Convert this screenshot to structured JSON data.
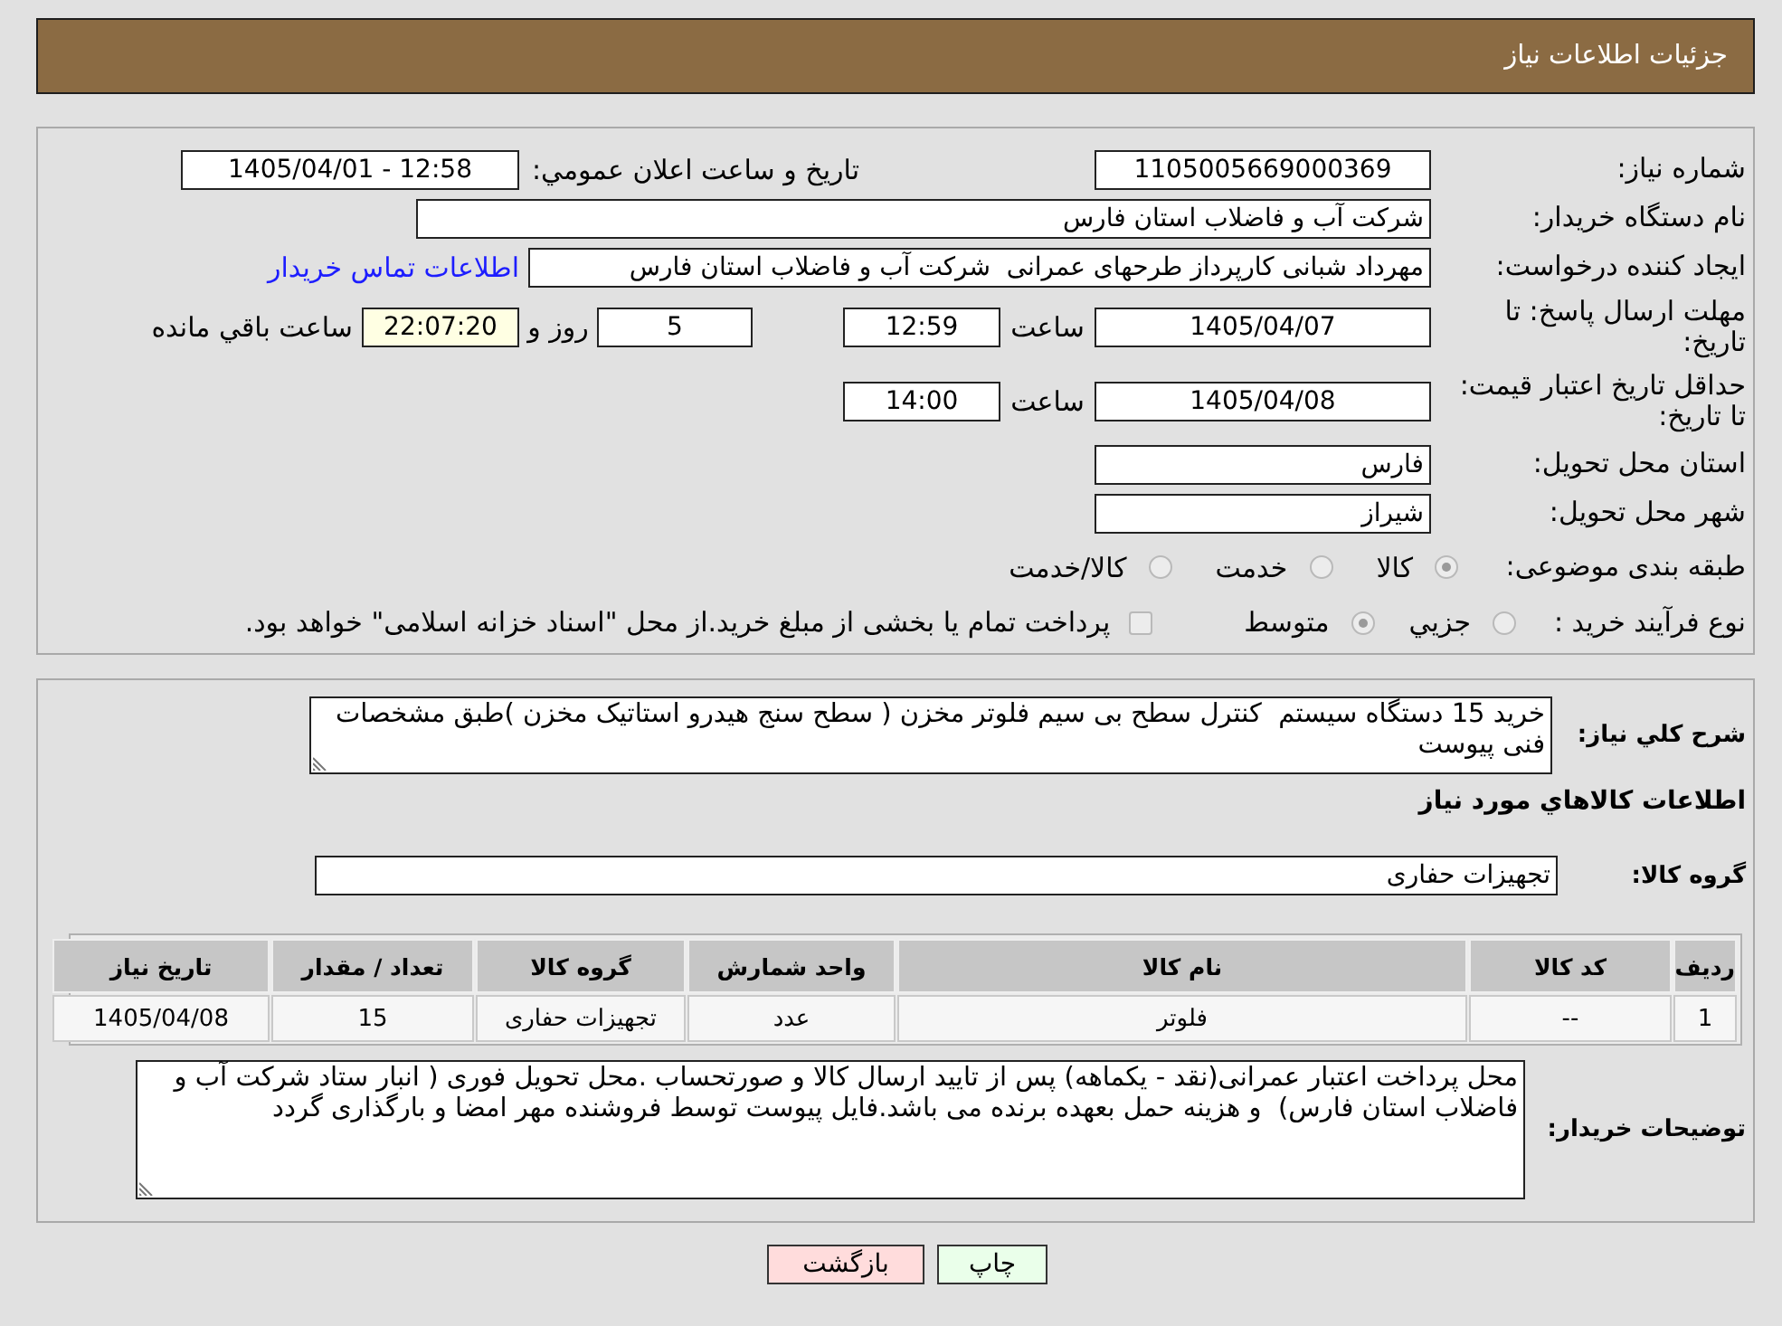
{
  "header": {
    "title": "جزئیات اطلاعات نیاز"
  },
  "details": {
    "need_number": {
      "label": "شماره نیاز:",
      "value": "1105005669000369"
    },
    "announcement": {
      "label": "تاریخ و ساعت اعلان عمومي:",
      "value": "1405/04/01 - 12:58"
    },
    "buyer_org": {
      "label": "نام دستگاه خریدار:",
      "value": "شرکت آب و فاضلاب استان فارس"
    },
    "requester": {
      "label": "ایجاد کننده درخواست:",
      "value": "مهرداد شبانی کارپرداز طرحهای عمرانی  شرکت آب و فاضلاب استان فارس",
      "contact_link": "اطلاعات تماس خریدار"
    },
    "response_deadline": {
      "label": "مهلت ارسال پاسخ: تا تاریخ:",
      "date": "1405/04/07",
      "time_label": "ساعت",
      "time": "12:59",
      "days": "5",
      "days_label": "روز و",
      "remaining": "22:07:20",
      "remaining_label": "ساعت باقي مانده"
    },
    "price_validity": {
      "label": "حداقل تاریخ اعتبار قیمت: تا تاریخ:",
      "date": "1405/04/08",
      "time_label": "ساعت",
      "time": "14:00"
    },
    "delivery_province": {
      "label": "استان محل تحویل:",
      "value": "فارس"
    },
    "delivery_city": {
      "label": "شهر محل تحویل:",
      "value": "شیراز"
    },
    "category": {
      "label": "طبقه بندی موضوعی:",
      "options": [
        {
          "label": "کالا",
          "selected": true,
          "disabled": true
        },
        {
          "label": "خدمت",
          "selected": false,
          "disabled": true
        },
        {
          "label": "کالا/خدمت",
          "selected": false,
          "disabled": true
        }
      ]
    },
    "purchase_process": {
      "label": "نوع فرآیند خرید :",
      "options": [
        {
          "label": "جزيي",
          "selected": false,
          "disabled": true
        },
        {
          "label": "متوسط",
          "selected": true,
          "disabled": true
        }
      ],
      "treasury": {
        "label": "پرداخت تمام یا بخشی از مبلغ خرید.از محل \"اسناد خزانه اسلامی\" خواهد بود.",
        "checked": false,
        "disabled": true
      }
    }
  },
  "description": {
    "label": "شرح کلي نیاز:",
    "value": "خرید 15 دستگاه سیستم  کنترل سطح بی سیم فلوتر مخزن ( سطح سنج هیدرو استاتیک مخزن )طبق مشخصات فنی پیوست"
  },
  "goods": {
    "title": "اطلاعات کالاهاي مورد نیاز",
    "group_label": "گروه کالا:",
    "group_value": "تجهیزات حفاری",
    "table": {
      "columns": [
        "ردیف",
        "کد کالا",
        "نام کالا",
        "واحد شمارش",
        "گروه کالا",
        "تعداد / مقدار",
        "تاریخ نیاز"
      ],
      "rows": [
        [
          "1",
          "--",
          "فلوتر",
          "عدد",
          "تجهیزات حفاری",
          "15",
          "1405/04/08"
        ]
      ]
    }
  },
  "buyer_notes": {
    "label": "توضیحات خریدار:",
    "value": "محل پرداخت اعتبار عمرانی(نقد - یکماهه) پس از تایید ارسال کالا و صورتحساب .محل تحویل فوری ( انبار ستاد شرکت آب و فاضلاب استان فارس)  و هزینه حمل بعهده برنده می باشد.فایل پیوست توسط فروشنده مهر امضا و بارگذاری گردد"
  },
  "buttons": [
    {
      "label": "چاپ",
      "kind": "print"
    },
    {
      "label": "بازگشت",
      "kind": "back"
    }
  ]
}
